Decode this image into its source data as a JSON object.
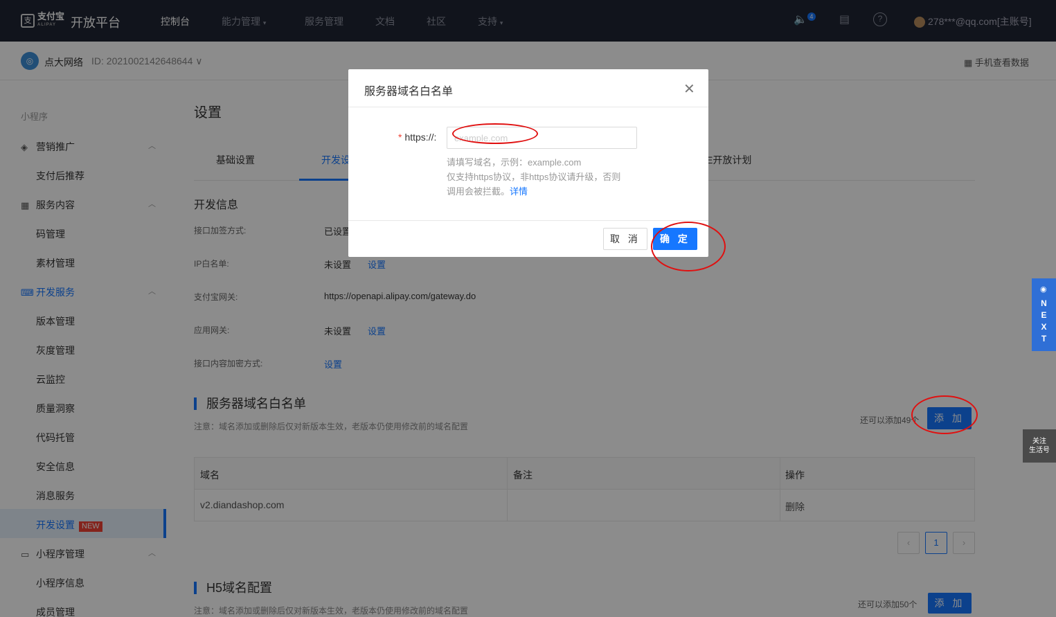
{
  "topnav": {
    "logo_text": "支付宝",
    "logo_sub": "ALIPAY",
    "platform": "开放平台",
    "items": [
      "控制台",
      "能力管理",
      "服务管理",
      "文档",
      "社区",
      "支持"
    ],
    "notifications": "4",
    "account": "278***@qq.com[主账号]"
  },
  "subbar": {
    "org_name": "点大网络",
    "org_id": "ID: 2021002142648644",
    "mobile_data": "手机查看数据"
  },
  "sidebar": {
    "title": "小程序",
    "groups": [
      {
        "label": "营销推广",
        "icon": "layers-icon"
      },
      {
        "label": "服务内容",
        "icon": "grid-icon"
      },
      {
        "label": "开发服务",
        "icon": "code-icon"
      },
      {
        "label": "小程序管理",
        "icon": "box-icon"
      }
    ],
    "items": [
      "支付后推荐",
      "码管理",
      "素材管理",
      "版本管理",
      "灰度管理",
      "云监控",
      "质量洞察",
      "代码托管",
      "安全信息",
      "消息服务",
      "开发设置",
      "小程序信息",
      "成员管理"
    ],
    "new_tag": "NEW"
  },
  "main": {
    "page_title": "设置",
    "tabs": [
      "基础设置",
      "开发设",
      "E开放计划"
    ],
    "dev_info_title": "开发信息",
    "fields": [
      {
        "label": "接口加签方式:",
        "value": "已设置",
        "link": ""
      },
      {
        "label": "IP白名单:",
        "value": "未设置",
        "link": "设置"
      },
      {
        "label": "支付宝网关:",
        "value": "https://openapi.alipay.com/gateway.do",
        "link": ""
      },
      {
        "label": "应用网关:",
        "value": "未设置",
        "link": "设置"
      },
      {
        "label": "接口内容加密方式:",
        "value": "",
        "link": "设置"
      }
    ],
    "whitelist": {
      "title": "服务器域名白名单",
      "note": "注意：域名添加或删除后仅对新版本生效，老版本仍使用修改前的域名配置",
      "quota": "还可以添加49个",
      "add_label": "添 加",
      "columns": [
        "域名",
        "备注",
        "操作"
      ],
      "rows": [
        {
          "domain": "v2.diandashop.com",
          "remark": "",
          "action": "删除"
        }
      ],
      "page": "1"
    },
    "h5": {
      "title": "H5域名配置",
      "note": "注意：域名添加或删除后仅对新版本生效，老版本仍使用修改前的域名配置",
      "quota": "还可以添加50个",
      "add_label": "添 加"
    }
  },
  "modal": {
    "title": "服务器域名白名单",
    "label": "https://:",
    "placeholder": "example.com",
    "help_line1": "请填写域名，示例：example.com",
    "help_line2": "仅支持https协议，非https协议请升级，否则",
    "help_line3": "调用会被拦截。",
    "help_link": "详情",
    "cancel": "取 消",
    "ok": "确 定"
  },
  "widgets": {
    "next": [
      "N",
      "E",
      "X",
      "T"
    ],
    "follow": [
      "关注",
      "生活号"
    ]
  }
}
